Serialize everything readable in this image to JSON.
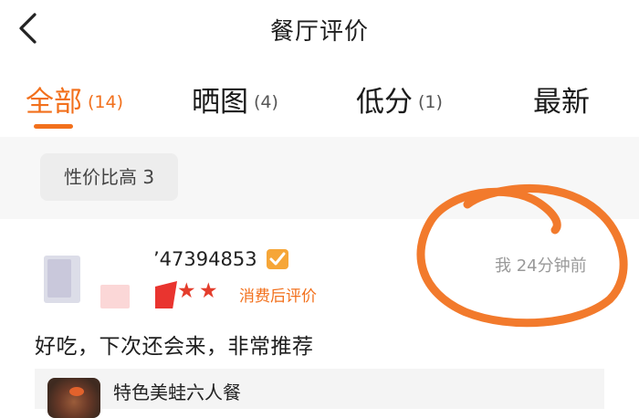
{
  "header": {
    "title": "餐厅评价",
    "back_icon": "chevron-left-icon"
  },
  "tabs": [
    {
      "label": "全部",
      "count": "(14)",
      "active": true
    },
    {
      "label": "晒图",
      "count": "(4)",
      "active": false
    },
    {
      "label": "低分",
      "count": "(1)",
      "active": false
    },
    {
      "label": "最新",
      "count": "",
      "active": false
    }
  ],
  "tags": [
    {
      "label": "性价比高 3"
    }
  ],
  "review": {
    "username": "’47394853",
    "verified_icon": "verified-badge-icon",
    "stars_visible": 2,
    "source_label": "消费后评价",
    "meta": "我  24分钟前",
    "text": "好吃，下次还会来，非常推荐",
    "dish": {
      "name": "特色美蛙六人餐"
    }
  },
  "colors": {
    "accent": "#f2701c",
    "star": "#e43d2c",
    "badge": "#f6a638",
    "annotation": "#f27a2c"
  }
}
